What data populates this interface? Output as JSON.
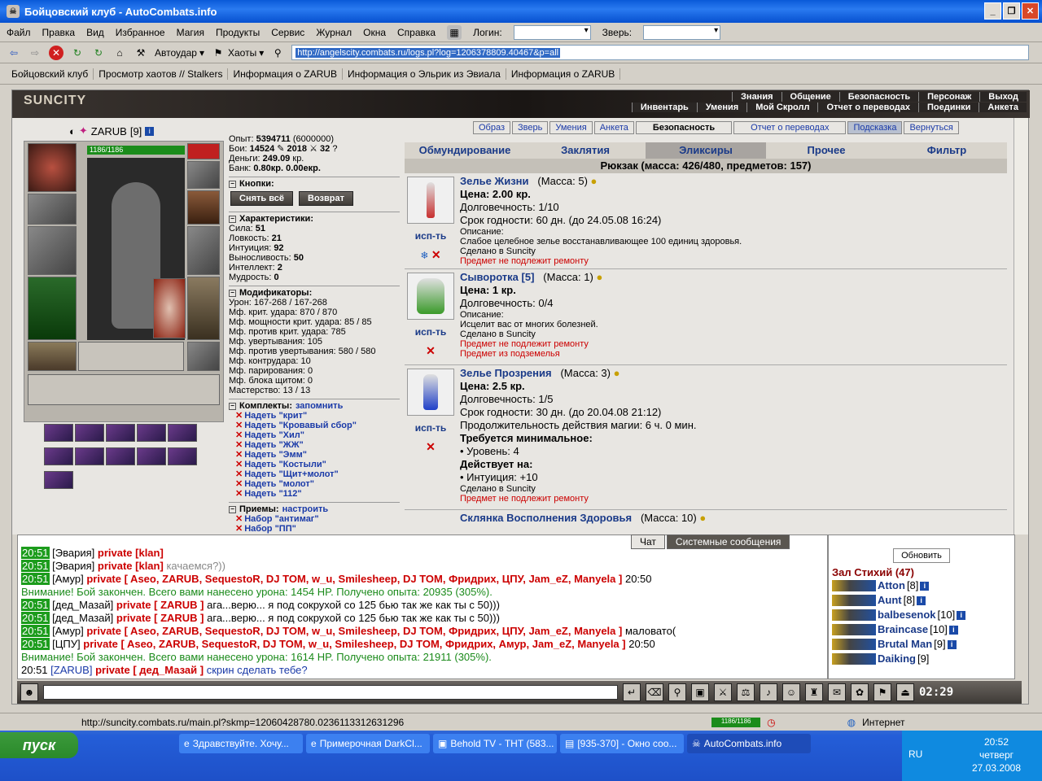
{
  "window": {
    "title": "Бойцовский клуб - AutoCombats.info"
  },
  "menu": [
    "Файл",
    "Правка",
    "Вид",
    "Избранное",
    "Магия",
    "Продукты",
    "Сервис",
    "Журнал",
    "Окна",
    "Справка"
  ],
  "login_label": "Логин:",
  "beast_label": "Зверь:",
  "toolbar": {
    "autoudar": "Автоудар",
    "haots": "Хаоты",
    "url": "http://angelscity.combats.ru/logs.pl?log=1206378809.40467&p=all"
  },
  "links": [
    "Бойцовский клуб",
    "Просмотр хаотов // Stalkers",
    "Информация о ZARUB",
    "Информация о Эльрик из Эвиала",
    "Информация о ZARUB"
  ],
  "game": {
    "logo": "SUNCITY",
    "topnav1": [
      "Знания",
      "Общение",
      "Безопасность",
      "Персонаж",
      "Выход"
    ],
    "topnav2": [
      "Инвентарь",
      "Умения",
      "Мой Скролл",
      "Отчет о переводах",
      "Поединки",
      "Анкета"
    ],
    "character": {
      "name": "ZARUB",
      "level": "[9]",
      "hp": "1186/1186"
    },
    "stats": {
      "exp_label": "Опыт:",
      "exp": "5394711",
      "exp_next": "(6000000)",
      "fights_label": "Бои:",
      "wins": "14524",
      "losses": "2018",
      "draws": "32",
      "money_label": "Деньги:",
      "money": "249.09",
      "money_unit": "кр.",
      "bank_label": "Банк:",
      "bank": "0.80кр. 0.00екр."
    },
    "buttons_header": "Кнопки:",
    "btn_remove": "Снять всё",
    "btn_return": "Возврат",
    "chars_header": "Характеристики:",
    "chars": [
      {
        "k": "Сила:",
        "v": "51"
      },
      {
        "k": "Ловкость:",
        "v": "21"
      },
      {
        "k": "Интуиция:",
        "v": "92"
      },
      {
        "k": "Выносливость:",
        "v": "50"
      },
      {
        "k": "Интеллект:",
        "v": "2"
      },
      {
        "k": "Мудрость:",
        "v": "0"
      }
    ],
    "mods_header": "Модификаторы:",
    "mods": [
      "Урон: 167-268 / 167-268",
      "Мф. крит. удара: 870 / 870",
      "Мф. мощности крит. удара: 85 / 85",
      "Мф. против крит. удара: 785",
      "Мф. увертывания: 105",
      "Мф. против увертывания: 580 / 580",
      "Мф. контрудара: 10",
      "Мф. парирования: 0",
      "Мф. блока щитом: 0",
      "Мастерство: 13 / 13"
    ],
    "sets_header": "Комплекты:",
    "sets_remember": "запомнить",
    "sets": [
      "Надеть \"крит\"",
      "Надеть \"Кровавый сбор\"",
      "Надеть \"Хил\"",
      "Надеть \"ЖЖ\"",
      "Надеть \"Эмм\"",
      "Надеть \"Костыли\"",
      "Надеть \"Щит+молот\"",
      "Надеть \"молот\"",
      "Надеть \"112\""
    ],
    "techniques_header": "Приемы:",
    "techniques_configure": "настроить",
    "techniques": [
      "Набор \"антимаг\"",
      "Набор \"ПП\""
    ],
    "right_tabs": [
      "Образ",
      "Зверь",
      "Умения",
      "Анкета",
      "Безопасность",
      "Отчет о переводах",
      "Подсказка",
      "Вернуться"
    ],
    "categories": [
      "Обмундирование",
      "Заклятия",
      "Эликсиры",
      "Прочее",
      "Фильтр"
    ],
    "bag_title": "Рюкзак (масса: 426/480, предметов: 157)",
    "use_label": "исп-ть",
    "items": [
      {
        "name": "Зелье Жизни",
        "mass": "(Масса: 5)",
        "price": "Цена: 2.00 кр.",
        "dur": "Долговечность: 1/10",
        "expiry": "Срок годности: 60 дн. (до 24.05.08 16:24)",
        "desc_label": "Описание:",
        "desc": "Слабое целебное зелье восстанавливающее 100 единиц здоровья.",
        "made": "Сделано в Suncity",
        "note": "Предмет не подлежит ремонту",
        "color": "#c83030"
      },
      {
        "name": "Сыворотка [5]",
        "mass": "(Масса: 1)",
        "price": "Цена: 1 кр.",
        "dur": "Долговечность: 0/4",
        "desc_label": "Описание:",
        "desc": "Исцелит вас от многих болезней.",
        "made": "Сделано в Suncity",
        "note": "Предмет не подлежит ремонту",
        "note2": "Предмет из подземелья",
        "color": "#3a9a2a"
      },
      {
        "name": "Зелье Прозрения",
        "mass": "(Масса: 3)",
        "price": "Цена: 2.5 кр.",
        "dur": "Долговечность: 1/5",
        "expiry": "Срок годности: 30 дн. (до 20.04.08 21:12)",
        "magic": "Продолжительность действия магии: 6 ч. 0 мин.",
        "req": "Требуется минимальное:",
        "req1": "• Уровень: 4",
        "acts": "Действует на:",
        "act1": "• Интуиция: +10",
        "made": "Сделано в Suncity",
        "note": "Предмет не подлежит ремонту",
        "color": "#2040c8"
      },
      {
        "name": "Склянка Восполнения Здоровья",
        "mass": "(Масса: 10)",
        "color": "#aa3030"
      }
    ]
  },
  "chat": {
    "tabs": [
      "Чат",
      "Системные сообщения"
    ],
    "lines": [
      {
        "t": "20:51",
        "who": "[Эвария]",
        "priv": "private [klan]",
        "msg": ""
      },
      {
        "t": "20:51",
        "who": "[Эвария]",
        "priv": "private [klan]",
        "msg": "качаемся?))"
      },
      {
        "t": "20:51",
        "who": "[Амур]",
        "priv": "private [ Aseo, ZARUB, SequestoR, DJ TOM, w_u, Smilesheep, DJ TOM, Фридрих, ЦПУ, Jam_eZ, Manyela ]",
        "msg": "20:50"
      },
      {
        "sys": "Внимание! Бой закончен. Всего вами нанесено урона: 1454 HP. Получено опыта: 20935 (305%)."
      },
      {
        "t": "20:51",
        "who": "[дед_Мазай]",
        "priv": "private [ ZARUB ]",
        "msg": "ага...верю... я под сокрухой со 125 бью так же как ты с 50)))"
      },
      {
        "t": "20:51",
        "who": "[дед_Мазай]",
        "priv": "private [ ZARUB ]",
        "msg": "ага...верю... я под сокрухой со 125 бью так же как ты с 50)))"
      },
      {
        "t": "20:51",
        "who": "[Амур]",
        "priv": "private [ Aseo, ZARUB, SequestoR, DJ TOM, w_u, Smilesheep, DJ TOM, Фридрих, ЦПУ, Jam_eZ, Manyela ]",
        "msg": "маловато("
      },
      {
        "t": "20:51",
        "who": "[ЦПУ]",
        "priv": "private [ Aseo, ZARUB, SequestoR, DJ TOM, w_u, Smilesheep, DJ TOM, Фридрих, Амур, Jam_eZ, Manyela ]",
        "msg": "20:50"
      },
      {
        "sys": "Внимание! Бой закончен. Всего вами нанесено урона: 1614 HP. Получено опыта: 21911 (305%)."
      },
      {
        "t": "20:51",
        "who": "[ZARUB]",
        "priv": "private [ дед_Мазай ]",
        "msg": "скрин сделать тебе?",
        "self": true
      }
    ]
  },
  "room": {
    "refresh": "Обновить",
    "title": "Зал Стихий (47)",
    "users": [
      {
        "name": "Atton",
        "lvl": "[8]"
      },
      {
        "name": "Aunt",
        "lvl": "[8]"
      },
      {
        "name": "balbesenok",
        "lvl": "[10]"
      },
      {
        "name": "Braincase",
        "lvl": "[10]"
      },
      {
        "name": "Brutal Man",
        "lvl": "[9]"
      },
      {
        "name": "Daiking",
        "lvl": "[9]"
      }
    ]
  },
  "timer": "02:29",
  "status": {
    "url": "http://suncity.combats.ru/main.pl?skmp=12060428780.0236113312631296",
    "hp": "1186/1186",
    "zone": "Интернет"
  },
  "taskbar": {
    "start": "пуск",
    "tasks": [
      "Здравствуйте. Хочу...",
      "Примерочная DarkCl...",
      "Behold TV - ТНТ (583...",
      "[935-370] - Окно соо...",
      "AutoCombats.info"
    ],
    "lang": "RU",
    "time": "20:52",
    "day": "четверг",
    "date": "27.03.2008"
  }
}
